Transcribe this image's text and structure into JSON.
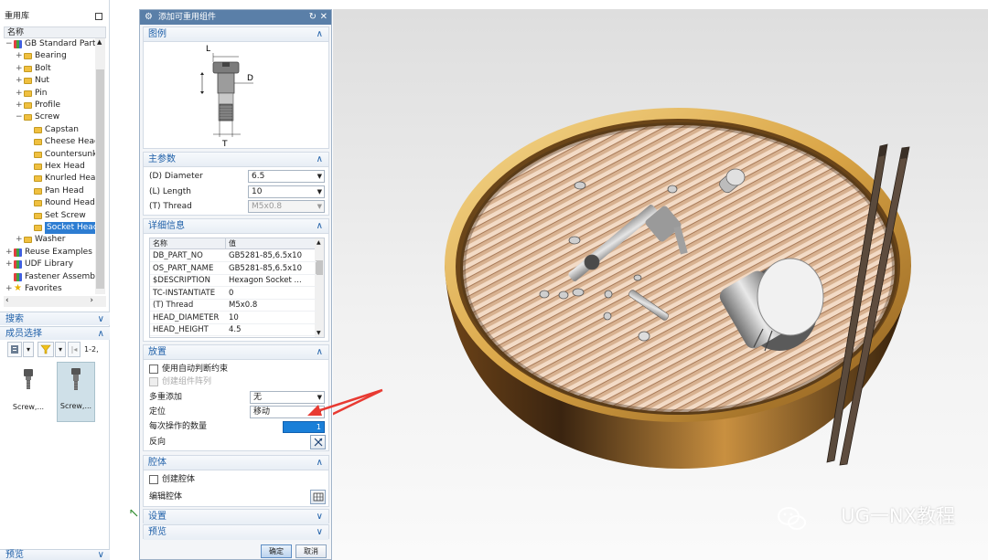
{
  "left_panel": {
    "title": "重用库",
    "column_header": "名称",
    "tree": [
      {
        "label": "GB Standard Parts",
        "level": 0,
        "expander": "−",
        "icon": "library-icon"
      },
      {
        "label": "Bearing",
        "level": 1,
        "expander": "+",
        "icon": "folder-icon"
      },
      {
        "label": "Bolt",
        "level": 1,
        "expander": "+",
        "icon": "folder-icon"
      },
      {
        "label": "Nut",
        "level": 1,
        "expander": "+",
        "icon": "folder-icon"
      },
      {
        "label": "Pin",
        "level": 1,
        "expander": "+",
        "icon": "folder-icon"
      },
      {
        "label": "Profile",
        "level": 1,
        "expander": "+",
        "icon": "folder-icon"
      },
      {
        "label": "Screw",
        "level": 1,
        "expander": "−",
        "icon": "folder-icon"
      },
      {
        "label": "Capstan",
        "level": 2,
        "expander": "",
        "icon": "folder-icon"
      },
      {
        "label": "Cheese Head",
        "level": 2,
        "expander": "",
        "icon": "folder-icon"
      },
      {
        "label": "Countersunk",
        "level": 2,
        "expander": "",
        "icon": "folder-icon"
      },
      {
        "label": "Hex Head",
        "level": 2,
        "expander": "",
        "icon": "folder-icon"
      },
      {
        "label": "Knurled Head",
        "level": 2,
        "expander": "",
        "icon": "folder-icon"
      },
      {
        "label": "Pan Head",
        "level": 2,
        "expander": "",
        "icon": "folder-icon"
      },
      {
        "label": "Round Head",
        "level": 2,
        "expander": "",
        "icon": "folder-icon"
      },
      {
        "label": "Set Screw",
        "level": 2,
        "expander": "",
        "icon": "folder-icon"
      },
      {
        "label": "Socket Head",
        "level": 2,
        "expander": "",
        "icon": "folder-icon",
        "selected": true
      },
      {
        "label": "Washer",
        "level": 1,
        "expander": "+",
        "icon": "folder-icon"
      },
      {
        "label": "Reuse Examples",
        "level": 0,
        "expander": "+",
        "icon": "library-icon"
      },
      {
        "label": "UDF Library",
        "level": 0,
        "expander": "+",
        "icon": "library-icon"
      },
      {
        "label": "Fastener Assembly",
        "level": 0,
        "expander": "",
        "icon": "library-icon"
      },
      {
        "label": "Favorites",
        "level": 0,
        "expander": "+",
        "icon": "star-icon"
      }
    ],
    "search_section": "搜索",
    "member_section": "成员选择",
    "page_info": "1-2,",
    "thumbnails": [
      {
        "caption": "Screw,...",
        "selected": false
      },
      {
        "caption": "Screw,...",
        "selected": true
      }
    ],
    "preview_section": "预览"
  },
  "dialog": {
    "title": "添加可重用组件",
    "illustration": {
      "header": "图例",
      "labels": {
        "L": "L",
        "D": "D",
        "T": "T"
      }
    },
    "main_params": {
      "header": "主参数",
      "rows": [
        {
          "label": "(D) Diameter",
          "value": "6.5",
          "disabled": false
        },
        {
          "label": "(L) Length",
          "value": "10",
          "disabled": false
        },
        {
          "label": "(T) Thread",
          "value": "M5x0.8",
          "disabled": true
        }
      ]
    },
    "details": {
      "header": "详细信息",
      "col_name": "名称",
      "col_value": "值",
      "rows": [
        {
          "name": "DB_PART_NO",
          "value": "GB5281-85,6.5x10"
        },
        {
          "name": "OS_PART_NAME",
          "value": "GB5281-85,6.5x10"
        },
        {
          "name": "$DESCRIPTION",
          "value": "Hexagon Socket ..."
        },
        {
          "name": "TC-INSTANTIATE",
          "value": "0"
        },
        {
          "name": "(T) Thread",
          "value": "M5x0.8"
        },
        {
          "name": "HEAD_DIAMETER",
          "value": "10"
        },
        {
          "name": "HEAD_HEIGHT",
          "value": "4.5"
        }
      ]
    },
    "placement": {
      "header": "放置",
      "auto_constraint": "使用自动判断约束",
      "create_array": "创建组件阵列",
      "multi_add_label": "多重添加",
      "multi_add_value": "无",
      "position_label": "定位",
      "position_value": "移动",
      "count_label": "每次操作的数量",
      "count_value": "1",
      "reverse_label": "反向"
    },
    "cavity": {
      "header": "腔体",
      "create_label": "创建腔体",
      "edit_label": "编辑腔体"
    },
    "settings_header": "设置",
    "preview_header": "预览",
    "ok": "确定",
    "cancel": "取消"
  },
  "viewport": {
    "watermark": "UG一NX教程",
    "annotation_arrow_color": "#e83a32"
  },
  "colors": {
    "accent": "#1e5fa8",
    "selection": "#2d7dd2",
    "titlebar": "#5a7fa8"
  }
}
